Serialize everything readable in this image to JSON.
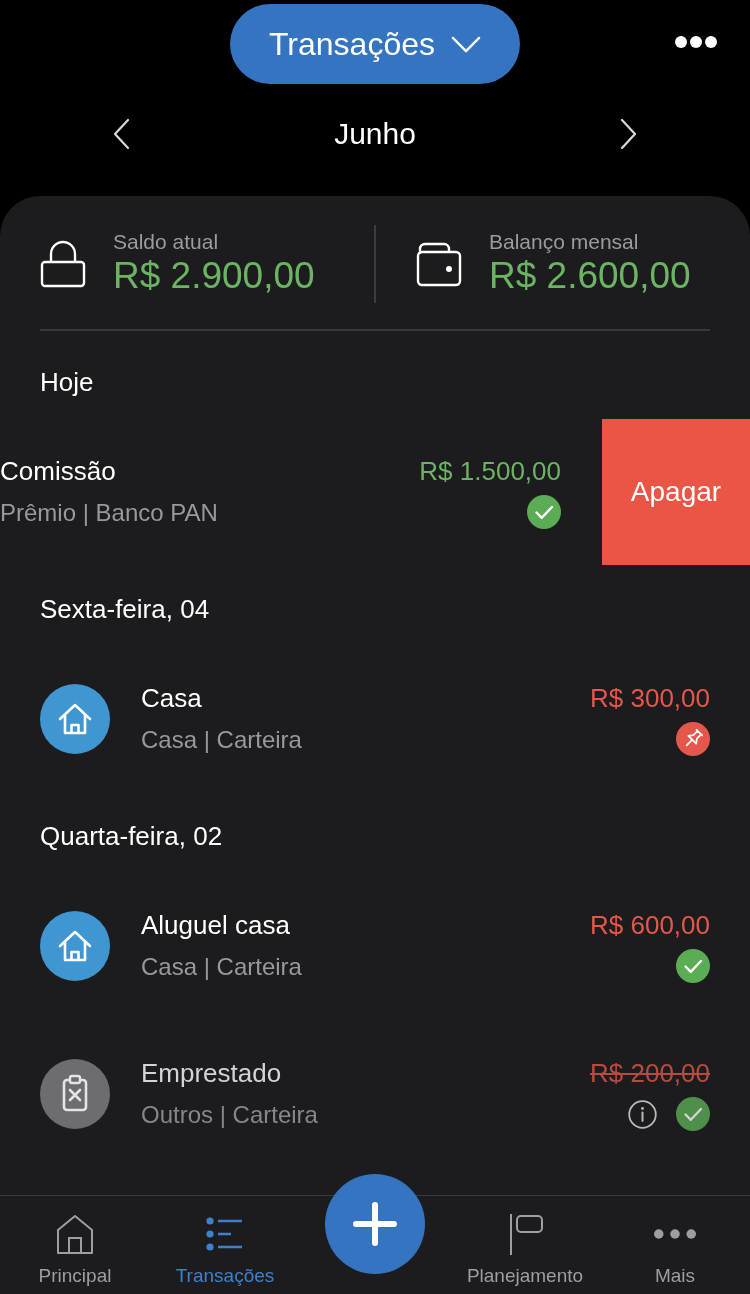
{
  "header": {
    "title": "Transações"
  },
  "month": {
    "label": "Junho"
  },
  "summary": [
    {
      "kind": "lock",
      "label": "Saldo atual",
      "value": "R$ 2.900,00"
    },
    {
      "kind": "wallet",
      "label": "Balanço mensal",
      "value": "R$ 2.600,00"
    }
  ],
  "groups": [
    {
      "date": "Hoje",
      "transactions": [
        {
          "kind": "income",
          "title": "Comissão",
          "subtitle": "Prêmio | Banco PAN",
          "amount": "R$ 1.500,00",
          "paid": true,
          "has_note": false,
          "ignored": false,
          "swiped": true,
          "delete_label": "Apagar"
        }
      ]
    },
    {
      "date": "Sexta-feira, 04",
      "transactions": [
        {
          "kind": "expense",
          "avatar": {
            "kind": "house",
            "color": "#4096d1"
          },
          "title": "Casa",
          "subtitle": "Casa | Carteira",
          "amount": "R$ 300,00",
          "paid": false,
          "has_note": false,
          "ignored": false,
          "swiped": false
        }
      ]
    },
    {
      "date": "Quarta-feira, 02",
      "transactions": [
        {
          "kind": "expense",
          "avatar": {
            "kind": "house",
            "color": "#4096d1"
          },
          "title": "Aluguel casa",
          "subtitle": "Casa | Carteira",
          "amount": "R$ 600,00",
          "paid": true,
          "has_note": false,
          "ignored": false,
          "swiped": false
        },
        {
          "kind": "expense",
          "avatar": {
            "kind": "clipboard",
            "color": "#6d6d71"
          },
          "title": "Emprestado",
          "subtitle": "Outros | Carteira",
          "amount": "R$ 200,00",
          "paid": true,
          "has_note": true,
          "ignored": true,
          "swiped": false
        }
      ]
    }
  ],
  "nav": {
    "items": [
      {
        "kind": "home",
        "label": "Principal",
        "selected": false
      },
      {
        "kind": "list",
        "label": "Transações",
        "selected": true
      },
      {
        "kind": "flag",
        "label": "Planejamento",
        "selected": false
      },
      {
        "kind": "dots",
        "label": "Mais",
        "selected": false
      }
    ]
  }
}
